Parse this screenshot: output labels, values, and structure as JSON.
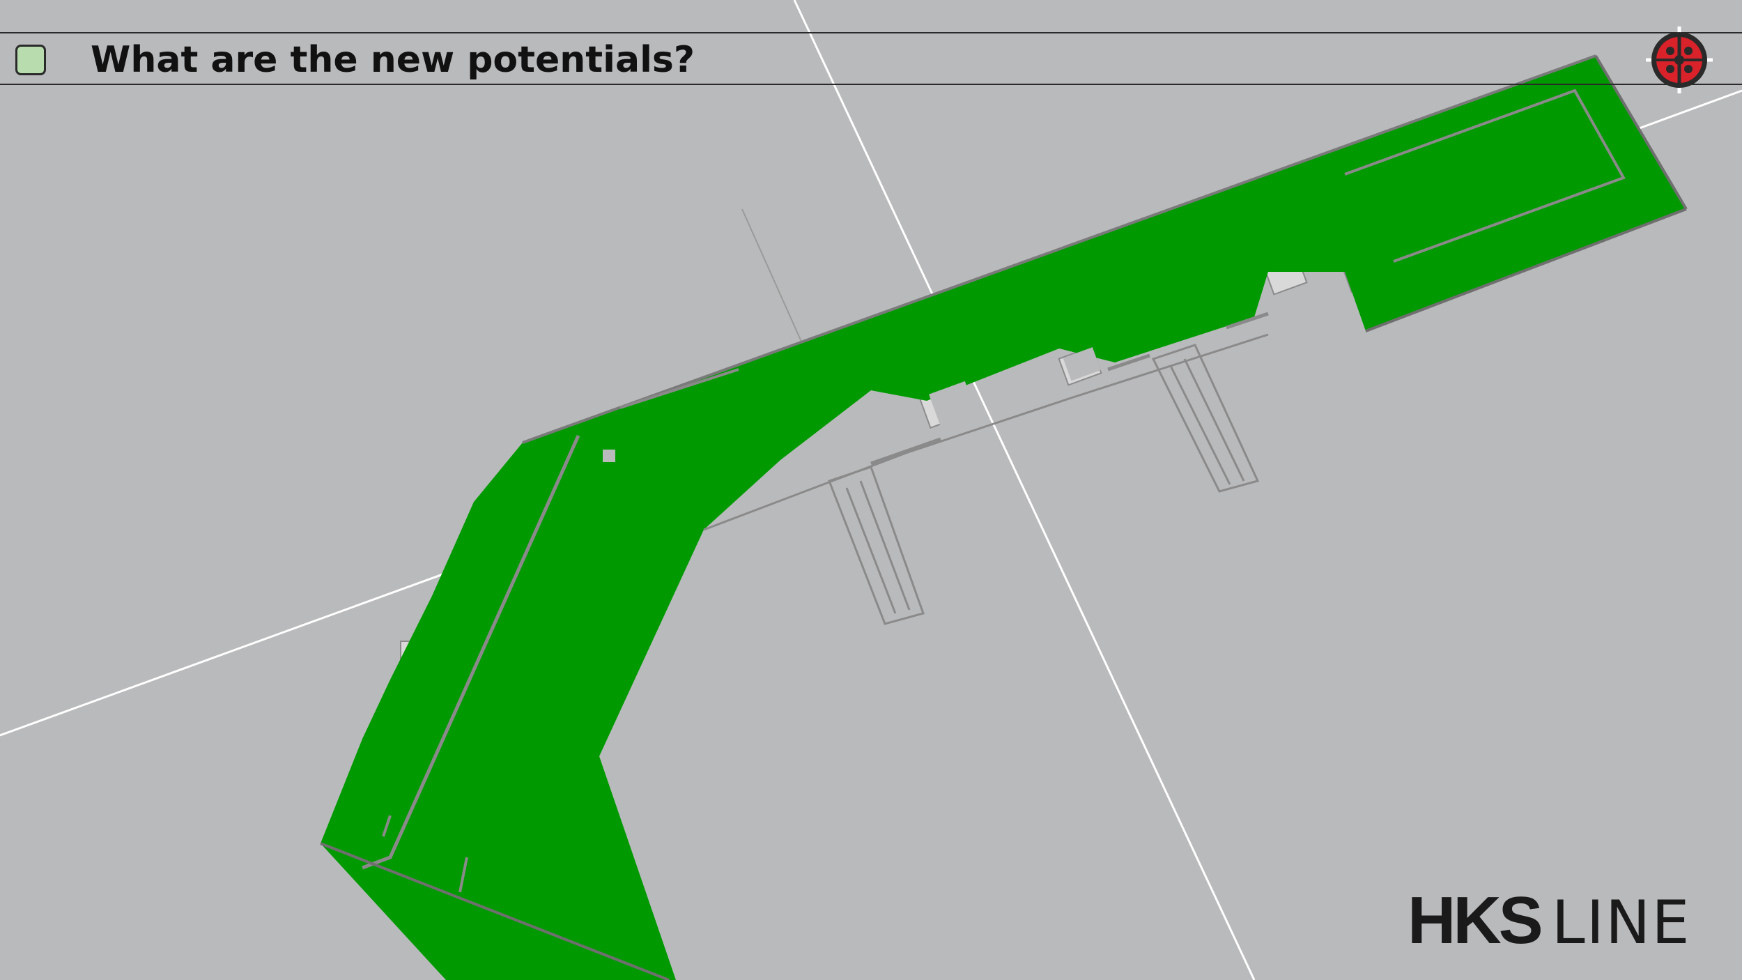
{
  "slide": {
    "title": "What are the new potentials?"
  },
  "branding": {
    "logo_primary": "HKS",
    "logo_secondary": "LINE"
  },
  "icons": {
    "title_bullet": "square-bullet-icon",
    "corner_logo": "ladybug-logo-icon"
  },
  "colors": {
    "background": "#b9babc",
    "model_green": "#009a00",
    "bullet_fill": "#b9dcae",
    "logo_red": "#d9222a"
  }
}
